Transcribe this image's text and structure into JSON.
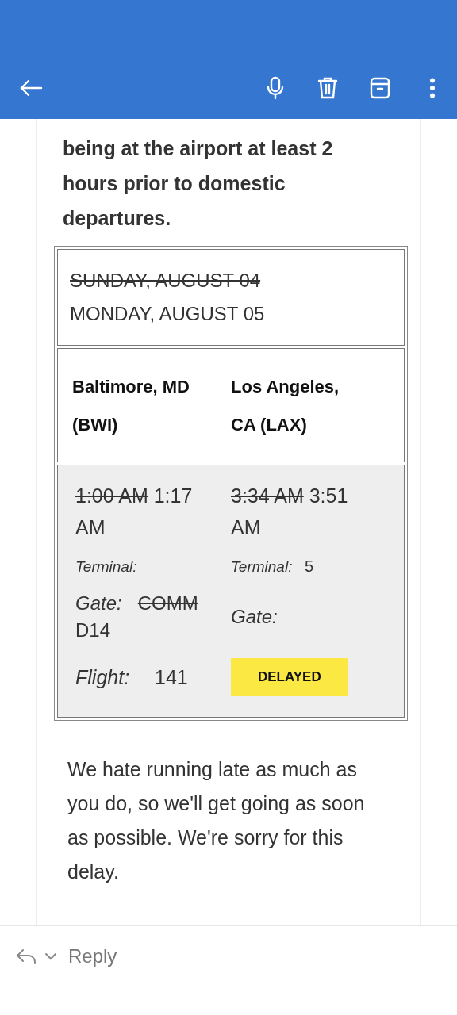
{
  "intro": "being at the airport at least 2 hours prior to domestic departures.",
  "itinerary": {
    "date": {
      "previous": "SUNDAY, AUGUST 04",
      "current": "MONDAY, AUGUST 05"
    },
    "departure": {
      "city": "Baltimore, MD (BWI)",
      "time": {
        "previous": "1:00 AM",
        "current": "1:17 AM"
      },
      "terminal_label": "Terminal:",
      "gate_label": "Gate:",
      "gate": {
        "previous": "COMM",
        "current": "D14"
      }
    },
    "arrival": {
      "city": "Los Angeles, CA (LAX)",
      "time": {
        "previous": "3:34 AM",
        "current": "3:51 AM"
      },
      "terminal_label": "Terminal:",
      "terminal": "5",
      "gate_label": "Gate:"
    },
    "flight_label": "Flight:",
    "flight": "141",
    "status": "DELAYED"
  },
  "message": "We hate running late as much as you do, so we'll get going as soon as possible. We're sorry for this delay.",
  "reply": {
    "label": "Reply"
  }
}
